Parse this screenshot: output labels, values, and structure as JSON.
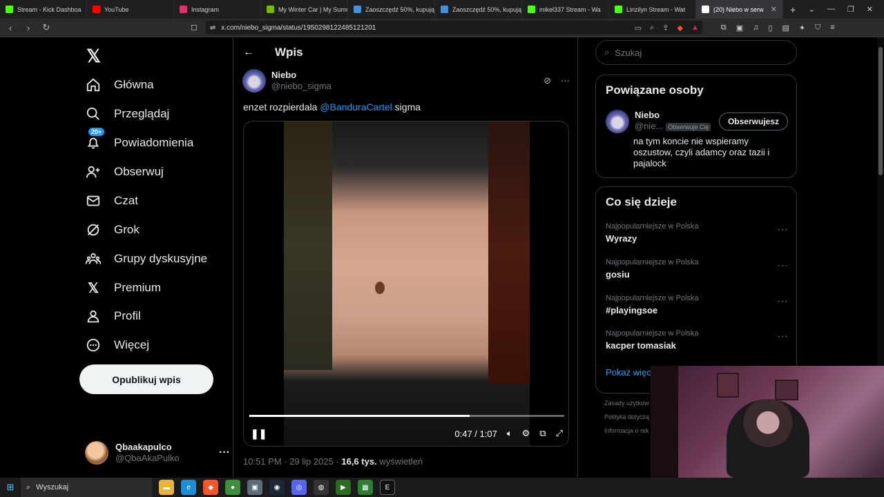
{
  "browser": {
    "tabs": [
      {
        "title": "Stream - Kick Dashboa",
        "color": "#53fc18"
      },
      {
        "title": "YouTube",
        "color": "#ff0000"
      },
      {
        "title": "Instagram",
        "color": "#e1306c"
      },
      {
        "title": "My Winter Car | My Summ",
        "color": "#76b900"
      },
      {
        "title": "Zaoszczędź 50%, kupując",
        "color": "#4a90d9"
      },
      {
        "title": "Zaoszczędź 50%, kupując",
        "color": "#4a90d9"
      },
      {
        "title": "mikel337 Stream - Wa",
        "color": "#53fc18"
      },
      {
        "title": "Linzilyn Stream - Wat",
        "color": "#53fc18"
      },
      {
        "title": "(20) Niebo w serw",
        "color": "#ffffff"
      }
    ],
    "url": "x.com/niebo_sigma/status/1950298122485121201"
  },
  "nav": {
    "items": [
      {
        "label": "Główna",
        "icon": "home-icon"
      },
      {
        "label": "Przeglądaj",
        "icon": "search-icon"
      },
      {
        "label": "Powiadomienia",
        "icon": "bell-icon"
      },
      {
        "label": "Obserwuj",
        "icon": "follow-icon"
      },
      {
        "label": "Czat",
        "icon": "mail-icon"
      },
      {
        "label": "Grok",
        "icon": "grok-icon"
      },
      {
        "label": "Grupy dyskusyjne",
        "icon": "communities-icon"
      },
      {
        "label": "Premium",
        "icon": "x-icon"
      },
      {
        "label": "Profil",
        "icon": "profile-icon"
      },
      {
        "label": "Więcej",
        "icon": "more-icon"
      }
    ],
    "notif_badge": "20+",
    "post_button": "Opublikuj wpis",
    "user": {
      "name": "Qbaakapulco",
      "handle": "@QbaAkaPulko"
    }
  },
  "main": {
    "header": "Wpis",
    "author": {
      "name": "Niebo",
      "handle": "@niebo_sigma"
    },
    "tweet": {
      "before": "enzet rozpierdala ",
      "mention": "@BanduraCartel",
      "after": " sigma"
    },
    "video": {
      "time": "0:47 / 1:07",
      "progress": 0.7
    },
    "meta": {
      "time": "10:51 PM · 29 lip 2025 · ",
      "views": "16,6 tys.",
      "views_label": " wyświetleń"
    }
  },
  "right": {
    "search_placeholder": "Szukaj",
    "related": {
      "title": "Powiązane osoby",
      "name": "Niebo",
      "handle": "@nie...",
      "badge": "Obserwuje Cię",
      "button": "Obserwujesz",
      "bio": "na tym koncie nie wspieramy oszustow, czyli adamcy oraz tazii i pajalock"
    },
    "trends": {
      "title": "Co się dzieje",
      "items": [
        {
          "context": "Najpopularniejsze w Polska",
          "topic": "Wyrazy"
        },
        {
          "context": "Najpopularniejsze w Polska",
          "topic": "gosiu"
        },
        {
          "context": "Najpopularniejsze w Polska",
          "topic": "#playingsoe"
        },
        {
          "context": "Najpopularniejsze w Polska",
          "topic": "kacper tomasiak"
        }
      ],
      "show_more": "Pokaż więce"
    },
    "footer": [
      "Zasady użytkow",
      "Polityka dotyczą",
      "Informacja o rek"
    ]
  },
  "taskbar": {
    "search": "Wyszukaj"
  }
}
